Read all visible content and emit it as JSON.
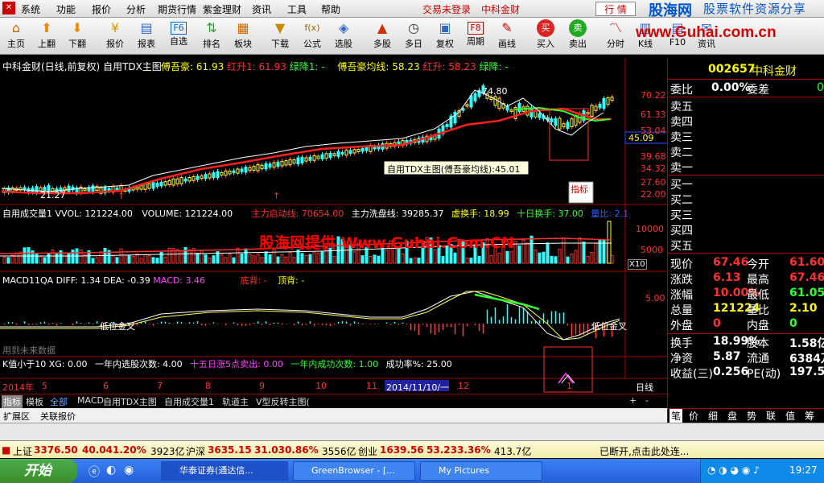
{
  "menu": {
    "items": [
      "系统",
      "功能",
      "报价",
      "分析",
      "期货行情",
      "紫金理财",
      "资讯",
      "工具",
      "帮助"
    ],
    "status": "交易未登录",
    "stock_name": "中科金财",
    "quote_btn": "行  情"
  },
  "watermark_brand": {
    "logo": "股海网",
    "slogan": "股票软件资源分享",
    "url": "www.Guhai.com.cn"
  },
  "toolbar": {
    "buttons": [
      "主页",
      "上翻",
      "下翻",
      "报价",
      "报表",
      "自选",
      "排名",
      "板块",
      "下载",
      "公式",
      "选股",
      "多股",
      "多日",
      "复权",
      "周期",
      "画线",
      "买入",
      "卖出",
      "分时",
      "K线",
      "F10",
      "资讯"
    ]
  },
  "chart": {
    "title": "中科金财(日线,前复权) 自用TDX主图",
    "main_indicators": [
      {
        "label": "傅吾豪: 61.93",
        "color": "#ffff00"
      },
      {
        "label": "红升1: 61.93",
        "color": "#ff3030"
      },
      {
        "label": "绿降1: -",
        "color": "#30ff30"
      },
      {
        "label": "傅吾豪均线: 58.23",
        "color": "#ffff00"
      },
      {
        "label": "红升: 58.23",
        "color": "#ff3030"
      },
      {
        "label": "绿降: -",
        "color": "#30ff30"
      }
    ],
    "price_axis": [
      "70.22",
      "61.33",
      "53.04",
      "45.09",
      "39.68",
      "34.32",
      "27.60",
      "22.00"
    ],
    "current_price_tag": "45.09",
    "high_label": "74.80",
    "low_label": "21.27",
    "tooltip": "自用TDX主图(傅吾豪均线):45.01",
    "indicator_tag": "指标",
    "buy_markers": [
      "↑",
      "↑"
    ],
    "volume": {
      "title": "自用成交量1",
      "items": [
        {
          "label": "VVOL: 121224.00",
          "color": "#ffffff"
        },
        {
          "label": "VOLUME: 121224.00",
          "color": "#ffffff"
        },
        {
          "label": "主力启动线: 70654.00",
          "color": "#ff3030"
        },
        {
          "label": "主力洗盘线: 39285.37",
          "color": "#ffffff"
        },
        {
          "label": "虚换手: 18.99",
          "color": "#ffff00"
        },
        {
          "label": "十日换手: 37.00",
          "color": "#30ff30"
        },
        {
          "label": "量比: 2.1",
          "color": "#3060ff"
        }
      ],
      "axis": [
        "10000",
        "5000"
      ],
      "unit": "X10"
    },
    "macd": {
      "title": "MACD11QA",
      "items": [
        {
          "label": "DIFF: 1.34",
          "color": "#ffffff"
        },
        {
          "label": "DEA: -0.39",
          "color": "#ffffff"
        },
        {
          "label": "MACD: 3.46",
          "color": "#ff40ff"
        },
        {
          "label": "底背: -",
          "color": "#ff3030"
        },
        {
          "label": "顶背: -",
          "color": "#ffff00"
        }
      ],
      "axis": "5.00",
      "low_cross_1": "低位金叉",
      "low_cross_2": "低位金叉",
      "future_note": "用到未来数据"
    },
    "kdj": {
      "items": [
        {
          "label": "K值小于10 XG: 0.00",
          "color": "#ffffff"
        },
        {
          "label": "一年内选股次数: 4.00",
          "color": "#ffffff"
        },
        {
          "label": "十五日涨5点卖出: 0.00",
          "color": "#ff40ff"
        },
        {
          "label": "一年内成功次数: 1.00",
          "color": "#30ff30"
        },
        {
          "label": "成功率%: 25.00",
          "color": "#ffffff"
        }
      ]
    },
    "time_axis": {
      "year": "2014年",
      "ticks": [
        "5",
        "6",
        "7",
        "8",
        "9",
        "10",
        "11",
        "12",
        "1"
      ],
      "cursor_date": "2014/11/10/一",
      "period": "日线"
    },
    "watermark": "股海网提供 Www.Guhai.Com.CN"
  },
  "tabs": [
    "指标",
    "模板",
    "全部",
    "MACD",
    "自用TDX主图",
    "自用成交量1",
    "轨道主",
    "V型反转主图("
  ],
  "tab_ctrl": [
    "+",
    "-"
  ],
  "ext": [
    "扩展区",
    "关联报价"
  ],
  "right_panel": {
    "code": "002657",
    "name": "中科金财",
    "weibi_label": "委比",
    "weibi_value": "0.00%",
    "weicha_label": "委差",
    "weicha_value": "0",
    "sell": [
      "卖五",
      "卖四",
      "卖三",
      "卖二",
      "卖一"
    ],
    "buy": [
      "买一",
      "买二",
      "买三",
      "买四",
      "买五"
    ],
    "stats": [
      {
        "l1": "现价",
        "v1": "67.46",
        "l2": "今开",
        "v2": "61.60"
      },
      {
        "l1": "涨跌",
        "v1": "6.13",
        "l2": "最高",
        "v2": "67.46"
      },
      {
        "l1": "涨幅",
        "v1": "10.00%",
        "l2": "最低",
        "v2": "61.05"
      },
      {
        "l1": "总量",
        "v1": "121224",
        "l2": "量比",
        "v2": "2.10"
      },
      {
        "l1": "外盘",
        "v1": "0",
        "l2": "内盘",
        "v2": "0"
      }
    ],
    "stats2": [
      {
        "l1": "换手",
        "v1": "18.99%",
        "l2": "股本",
        "v2": "1.58亿"
      },
      {
        "l1": "净资",
        "v1": "5.87",
        "l2": "流通",
        "v2": "6384万"
      },
      {
        "l1": "收益(三)",
        "v1": "0.256",
        "l2": "PE(动)",
        "v2": "197.5"
      }
    ],
    "bottom_tabs": [
      "笔",
      "价",
      "细",
      "盘",
      "势",
      "联",
      "值",
      "筹"
    ]
  },
  "status": {
    "sh": {
      "label": "上证",
      "price": "3376.50",
      "chg": "40.04",
      "pct": "1.20%",
      "amt": "3923亿"
    },
    "sz": {
      "label": "沪深",
      "price": "3635.15",
      "chg": "31.03",
      "pct": "0.86%",
      "amt": "3556亿"
    },
    "cy": {
      "label": "创业",
      "price": "1639.56",
      "chg": "53.23",
      "pct": "3.36%",
      "amt": "413.7亿"
    },
    "msg": "已断开,点击此处连..."
  },
  "taskbar": {
    "start": "开始",
    "tasks": [
      "华泰证券(通达信...",
      "GreenBrowser - [...",
      "My Pictures"
    ],
    "clock": "19:27"
  }
}
